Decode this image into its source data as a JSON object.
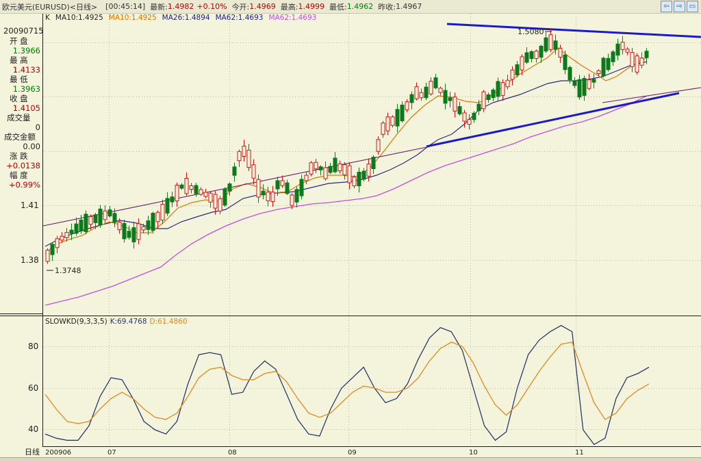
{
  "title_bar": {
    "instrument": "欧元美元(EURUSD)<日线>",
    "time": "[00:45:14]",
    "latest_label": "最新:",
    "latest_value": "1.4982",
    "change_pct": "+0.10%",
    "open_label": "今开:",
    "open_value": "1.4969",
    "high_label": "最高:",
    "high_value": "1.4999",
    "low_label": "最低:",
    "low_value": "1.4962",
    "prev_close_label": "昨收:",
    "prev_close_value": "1.4967"
  },
  "window_buttons": [
    "⇦",
    "⇨",
    "▭"
  ],
  "info_panel": {
    "date": "20090715",
    "open_label": "开  盘",
    "open_value": "1.3966",
    "high_label": "最  高",
    "high_value": "1.4133",
    "low_label": "最  低",
    "low_value": "1.3963",
    "close_label": "收  盘",
    "close_value": "1.4105",
    "volume_label": "成交量",
    "volume_value": "0",
    "amount_label": "成交金额",
    "amount_value": "0.00",
    "change_label": "涨  跌",
    "change_value": "+0.0138",
    "range_label": "幅  度",
    "range_value": "+0.99%"
  },
  "ma_legend": [
    {
      "text": "K",
      "color": "#222222"
    },
    {
      "text": "MA10:1.4925",
      "color": "#222222"
    },
    {
      "text": "MA10:1.4925",
      "color": "#e07800"
    },
    {
      "text": "MA26:1.4894",
      "color": "#1e1e7a"
    },
    {
      "text": "MA62:1.4693",
      "color": "#1e1e7a"
    },
    {
      "text": "MA62:1.4693",
      "color": "#c050e0"
    }
  ],
  "kd_legend": {
    "name": "SLOWKD(9,3,3,5)",
    "k_text": "K:69.4768",
    "d_text": "D:61.4860"
  },
  "colors": {
    "background": "#f4f3dc",
    "up_candle": "#d01818",
    "down_candle": "#0a7a1a",
    "ma10": "#e07800",
    "ma26": "#2a2a80",
    "ma62": "#c050e0",
    "trendline": "#1a1acc",
    "k_line": "#2a3a6a",
    "d_line": "#e08a20"
  },
  "chart_data": [
    {
      "type": "candlestick",
      "title": "欧元美元(EURUSD)<日线>",
      "price_axis_ticks": [
        1.41,
        1.38
      ],
      "high_label": "1.5080",
      "low_label": "1.3748",
      "x_labels": [
        "200906",
        "07",
        "08",
        "09",
        "10",
        "11"
      ],
      "candle_count": 126,
      "ohlc": [],
      "grid": true
    },
    {
      "type": "line",
      "title": "SLOWKD(9,3,3,5)",
      "ylim": [
        30,
        95
      ],
      "y_ticks": [
        80,
        60,
        40
      ],
      "series": [
        {
          "name": "K",
          "values": [
            38,
            36,
            35,
            35,
            42,
            56,
            65,
            64,
            55,
            44,
            40,
            38,
            44,
            62,
            76,
            77,
            76,
            57,
            58,
            68,
            73,
            69,
            57,
            45,
            38,
            37,
            50,
            60,
            65,
            70,
            60,
            53,
            55,
            62,
            74,
            84,
            89,
            87,
            78,
            60,
            42,
            35,
            39,
            60,
            76,
            83,
            87,
            90,
            87,
            40,
            33,
            36,
            55,
            65,
            67,
            70
          ]
        },
        {
          "name": "D",
          "values": [
            57,
            50,
            44,
            43,
            44,
            50,
            55,
            58,
            55,
            50,
            46,
            45,
            48,
            56,
            65,
            69,
            70,
            66,
            64,
            64,
            67,
            68,
            63,
            55,
            48,
            46,
            48,
            53,
            58,
            61,
            60,
            58,
            58,
            60,
            65,
            73,
            79,
            82,
            80,
            72,
            61,
            52,
            47,
            52,
            60,
            68,
            75,
            81,
            82,
            67,
            53,
            45,
            48,
            55,
            59,
            62
          ]
        }
      ]
    }
  ],
  "bottom_label": "日线"
}
